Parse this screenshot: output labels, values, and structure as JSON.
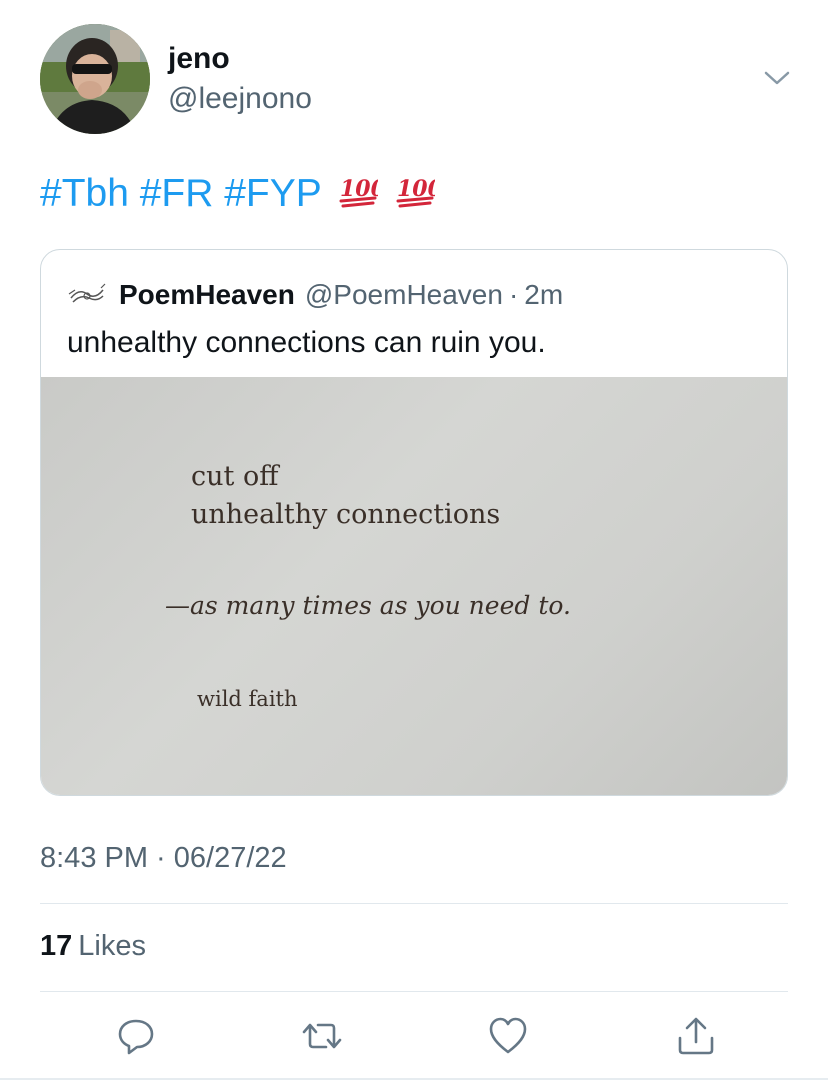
{
  "author": {
    "display_name": "jeno",
    "handle": "@leejnono"
  },
  "tweet": {
    "text": "#Tbh #FR #FYP",
    "emojis": [
      "100-emoji",
      "100-emoji"
    ],
    "timestamp": "8:43 PM · 06/27/22",
    "likes_count": "17",
    "likes_label": "Likes"
  },
  "quoted_tweet": {
    "display_name": "PoemHeaven",
    "handle": "@PoemHeaven",
    "separator": "·",
    "time": "2m",
    "text": "unhealthy connections can ruin you.",
    "image_text": {
      "line1": "cut off",
      "line2": "unhealthy connections",
      "line3": "—as many times as you need to.",
      "line4": "wild faith"
    }
  },
  "actions": [
    "reply-icon",
    "retweet-icon",
    "like-icon",
    "share-icon"
  ],
  "colors": {
    "link": "#1d9bf0",
    "secondary_text": "#536471",
    "primary_text": "#0f1419",
    "divider": "#e1e8ed",
    "emoji_red": "#d3263a"
  }
}
